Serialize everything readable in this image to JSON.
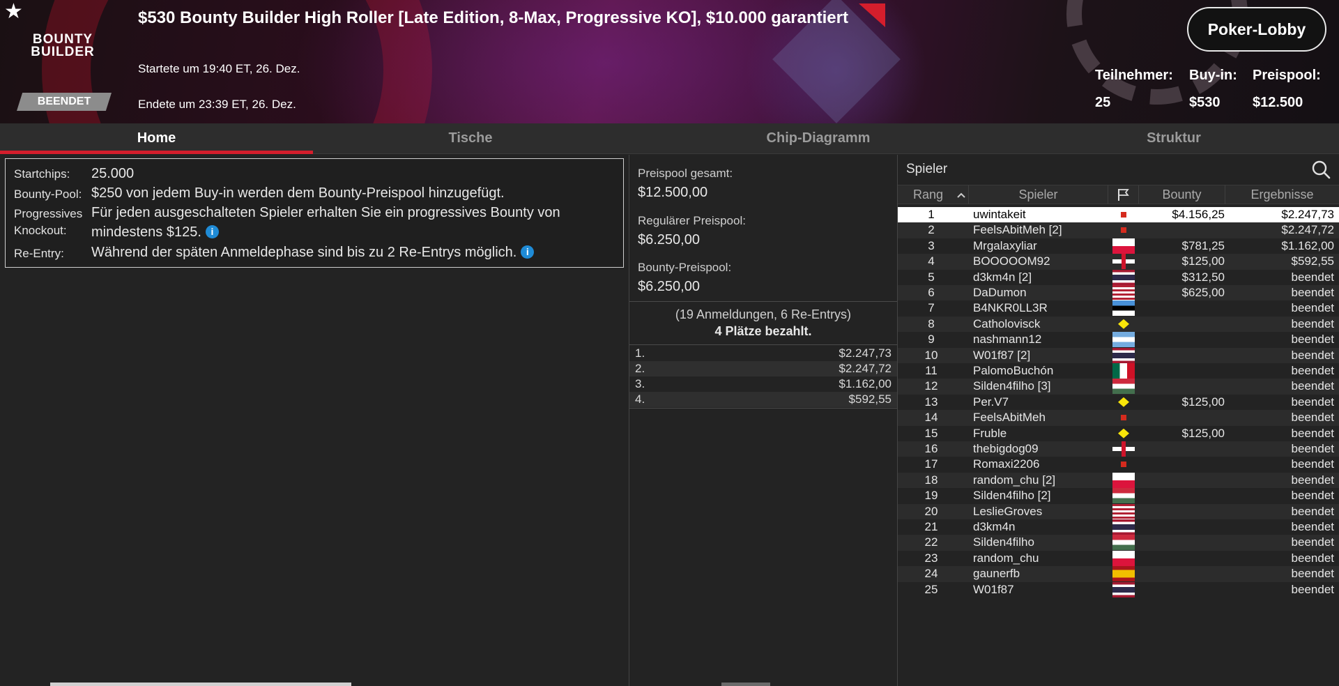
{
  "header": {
    "title": "$530 Bounty Builder High Roller [Late Edition, 8-Max, Progressive KO], $10.000 garantiert",
    "logo_line1": "BOUNTY",
    "logo_line2": "BUILDER",
    "status": "BEENDET",
    "started": "Startete um 19:40 ET, 26. Dez.",
    "ended": "Endete um 23:39 ET, 26. Dez.",
    "lobby_button": "Poker-Lobby",
    "stats": {
      "participants_label": "Teilnehmer:",
      "participants_value": "25",
      "buyin_label": "Buy-in:",
      "buyin_value": "$530",
      "prizepool_label": "Preispool:",
      "prizepool_value": "$12.500"
    }
  },
  "tabs": [
    "Home",
    "Tische",
    "Chip-Diagramm",
    "Struktur"
  ],
  "active_tab": "Home",
  "info": {
    "startchips_label": "Startchips:",
    "startchips_value": "25.000",
    "bountypool_label": "Bounty-Pool:",
    "bountypool_value": "$250 von jedem Buy-in werden dem Bounty-Preispool hinzugefügt.",
    "progressive_label_1": "Progressives",
    "progressive_label_2": "Knockout:",
    "progressive_value_1": "Für jeden ausgeschalteten Spieler erhalten Sie ein progressives Bounty von",
    "progressive_value_2": "mindestens $125.",
    "reentry_label": "Re-Entry:",
    "reentry_value": "Während der späten Anmeldephase sind bis zu 2 Re-Entrys möglich."
  },
  "prizepool": {
    "total_label": "Preispool gesamt:",
    "total_value": "$12.500,00",
    "regular_label": "Regulärer Preispool:",
    "regular_value": "$6.250,00",
    "bounty_label": "Bounty-Preispool:",
    "bounty_value": "$6.250,00",
    "registrations": "(19 Anmeldungen, 6 Re-Entrys)",
    "paid": "4 Plätze bezahlt.",
    "payouts": [
      {
        "pos": "1.",
        "amount": "$2.247,73"
      },
      {
        "pos": "2.",
        "amount": "$2.247,72"
      },
      {
        "pos": "3.",
        "amount": "$1.162,00"
      },
      {
        "pos": "4.",
        "amount": "$592,55"
      }
    ]
  },
  "players_table": {
    "search_placeholder": "Spieler",
    "columns": {
      "rank": "Rang",
      "player": "Spieler",
      "bounty": "Bounty",
      "result": "Ergebnisse"
    },
    "rows": [
      {
        "rank": "1",
        "name": "uwintakeit",
        "flag": "ca",
        "bounty": "$4.156,25",
        "result": "$2.247,73"
      },
      {
        "rank": "2",
        "name": "FeelsAbitMeh [2]",
        "flag": "ca",
        "bounty": "",
        "result": "$2.247,72"
      },
      {
        "rank": "3",
        "name": "Mrgalaxyliar",
        "flag": "pl",
        "bounty": "$781,25",
        "result": "$1.162,00"
      },
      {
        "rank": "4",
        "name": "BOOOOOM92",
        "flag": "uk",
        "bounty": "$125,00",
        "result": "$592,55"
      },
      {
        "rank": "5",
        "name": "d3km4n [2]",
        "flag": "th",
        "bounty": "$312,50",
        "result": "beendet"
      },
      {
        "rank": "6",
        "name": "DaDumon",
        "flag": "us",
        "bounty": "$625,00",
        "result": "beendet"
      },
      {
        "rank": "7",
        "name": "B4NKR0LL3R",
        "flag": "ee",
        "bounty": "",
        "result": "beendet"
      },
      {
        "rank": "8",
        "name": "Catholovisck",
        "flag": "br",
        "bounty": "",
        "result": "beendet"
      },
      {
        "rank": "9",
        "name": "nashmann12",
        "flag": "ar",
        "bounty": "",
        "result": "beendet"
      },
      {
        "rank": "10",
        "name": "W01f87 [2]",
        "flag": "th",
        "bounty": "",
        "result": "beendet"
      },
      {
        "rank": "11",
        "name": "PalomoBuchón",
        "flag": "mx",
        "bounty": "",
        "result": "beendet"
      },
      {
        "rank": "12",
        "name": "Silden4filho [3]",
        "flag": "hu",
        "bounty": "",
        "result": "beendet"
      },
      {
        "rank": "13",
        "name": "Per.V7",
        "flag": "br",
        "bounty": "$125,00",
        "result": "beendet"
      },
      {
        "rank": "14",
        "name": "FeelsAbitMeh",
        "flag": "ca",
        "bounty": "",
        "result": "beendet"
      },
      {
        "rank": "15",
        "name": "Fruble",
        "flag": "br",
        "bounty": "$125,00",
        "result": "beendet"
      },
      {
        "rank": "16",
        "name": "thebigdog09",
        "flag": "uk",
        "bounty": "",
        "result": "beendet"
      },
      {
        "rank": "17",
        "name": "Romaxi2206",
        "flag": "ca",
        "bounty": "",
        "result": "beendet"
      },
      {
        "rank": "18",
        "name": "random_chu [2]",
        "flag": "pl",
        "bounty": "",
        "result": "beendet"
      },
      {
        "rank": "19",
        "name": "Silden4filho [2]",
        "flag": "hu",
        "bounty": "",
        "result": "beendet"
      },
      {
        "rank": "20",
        "name": "LeslieGroves",
        "flag": "us",
        "bounty": "",
        "result": "beendet"
      },
      {
        "rank": "21",
        "name": "d3km4n",
        "flag": "th",
        "bounty": "",
        "result": "beendet"
      },
      {
        "rank": "22",
        "name": "Silden4filho",
        "flag": "hu",
        "bounty": "",
        "result": "beendet"
      },
      {
        "rank": "23",
        "name": "random_chu",
        "flag": "pl",
        "bounty": "",
        "result": "beendet"
      },
      {
        "rank": "24",
        "name": "gaunerfb",
        "flag": "es",
        "bounty": "",
        "result": "beendet"
      },
      {
        "rank": "25",
        "name": "W01f87",
        "flag": "th",
        "bounty": "",
        "result": "beendet"
      }
    ]
  },
  "colors": {
    "accent": "#d41e2c",
    "info_icon": "#1f8bd6",
    "badge": "#8c8c8c"
  },
  "icons": [
    "star-icon",
    "search-icon",
    "flag-icon",
    "sort-up-icon",
    "info-icon"
  ]
}
